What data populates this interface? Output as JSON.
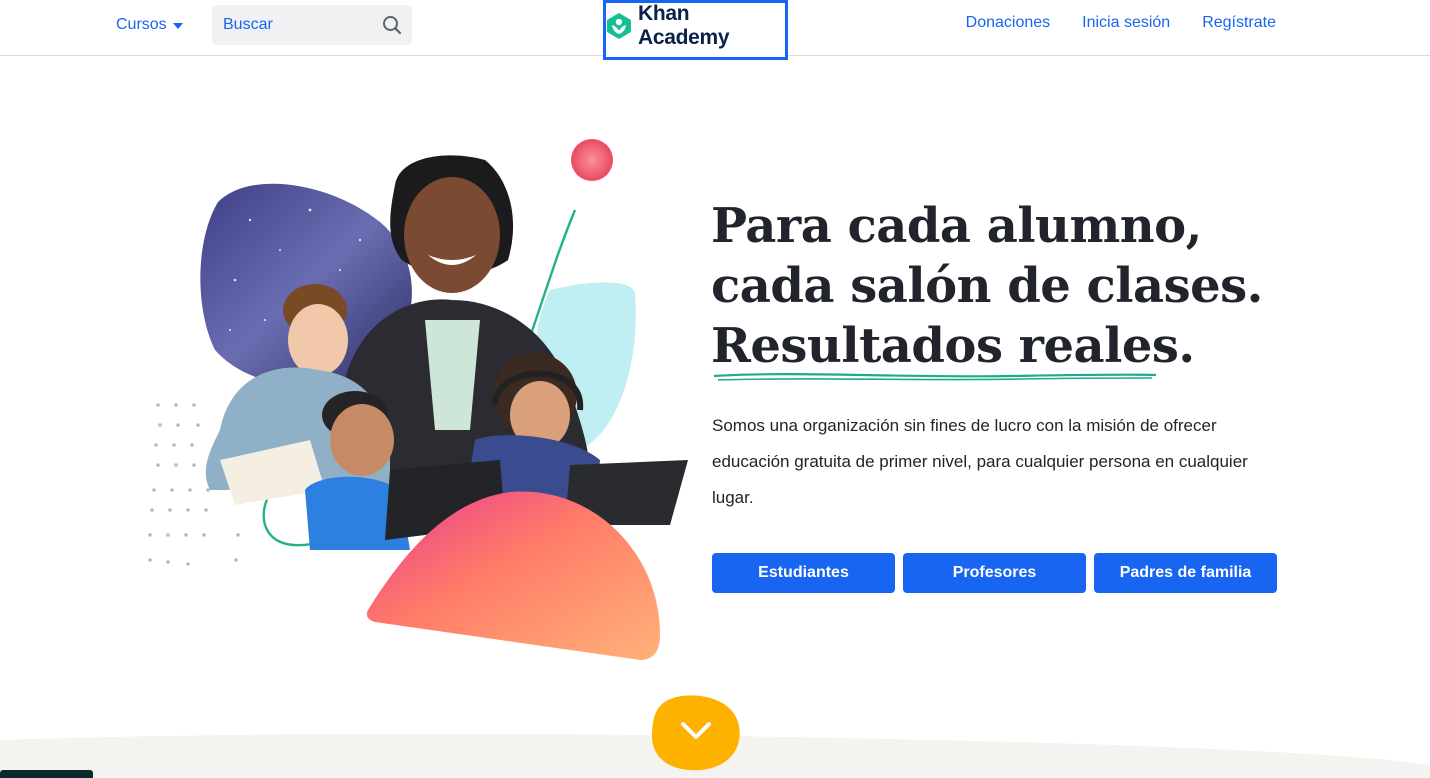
{
  "header": {
    "courses_label": "Cursos",
    "search_placeholder": "Buscar",
    "logo_text": "Khan Academy",
    "nav": {
      "donate": "Donaciones",
      "login": "Inicia sesión",
      "signup": "Regístrate"
    }
  },
  "hero": {
    "headline": {
      "line1": "Para cada alumno,",
      "line2": "cada salón de clases.",
      "line3": "Resultados reales."
    },
    "description": "Somos una organización sin fines de lucro con la misión de ofrecer educación gratuita de primer nivel, para cualquier persona en cualquier lugar.",
    "buttons": {
      "students": "Estudiantes",
      "teachers": "Profesores",
      "parents": "Padres de familia"
    }
  },
  "colors": {
    "primary": "#1865f2",
    "logo_green": "#14bf96",
    "text": "#21242c",
    "accent_yellow": "#ffb100"
  },
  "icons": [
    "chevron-down-icon",
    "search-icon",
    "khan-academy-logo-icon",
    "scroll-down-icon"
  ]
}
